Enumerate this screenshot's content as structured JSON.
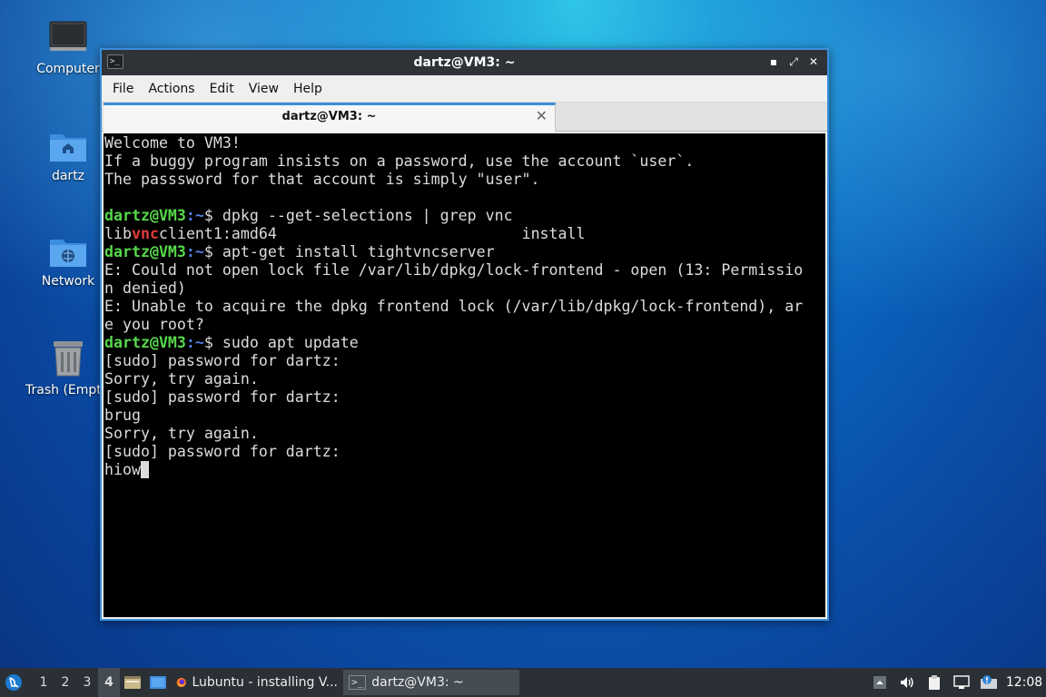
{
  "desktop": {
    "icons": [
      {
        "label": "Computer"
      },
      {
        "label": "dartz"
      },
      {
        "label": "Network"
      },
      {
        "label": "Trash (Empty)"
      }
    ]
  },
  "window": {
    "title": "dartz@VM3: ~",
    "menu": [
      "File",
      "Actions",
      "Edit",
      "View",
      "Help"
    ],
    "tab_label": "dartz@VM3: ~",
    "tab_close": "✕"
  },
  "terminal": {
    "lines": [
      {
        "text": "Welcome to VM3!"
      },
      {
        "text": "If a buggy program insists on a password, use the account `user`."
      },
      {
        "text": "The passsword for that account is simply \"user\"."
      },
      {
        "text": ""
      },
      {
        "prompt_user": "dartz@VM3",
        "prompt_path": ":~",
        "prompt_sym": "$ ",
        "cmd": "dpkg --get-selections | grep vnc"
      },
      {
        "pre": "lib",
        "hl": "vnc",
        "post": "client1:amd64                           install"
      },
      {
        "prompt_user": "dartz@VM3",
        "prompt_path": ":~",
        "prompt_sym": "$ ",
        "cmd": "apt-get install tightvncserver"
      },
      {
        "text": "E: Could not open lock file /var/lib/dpkg/lock-frontend - open (13: Permissio"
      },
      {
        "text": "n denied)"
      },
      {
        "text": "E: Unable to acquire the dpkg frontend lock (/var/lib/dpkg/lock-frontend), ar"
      },
      {
        "text": "e you root?"
      },
      {
        "prompt_user": "dartz@VM3",
        "prompt_path": ":~",
        "prompt_sym": "$ ",
        "cmd": "sudo apt update"
      },
      {
        "text": "[sudo] password for dartz:"
      },
      {
        "text": "Sorry, try again."
      },
      {
        "text": "[sudo] password for dartz:"
      },
      {
        "text": "brug"
      },
      {
        "text": "Sorry, try again."
      },
      {
        "text": "[sudo] password for dartz:"
      },
      {
        "text": "hiow",
        "cursor": true
      }
    ]
  },
  "taskbar": {
    "workspaces": [
      "1",
      "2",
      "3",
      "4"
    ],
    "active_workspace": "4",
    "tasks": [
      {
        "label": "Lubuntu - installing V...",
        "icon": "firefox-icon"
      },
      {
        "label": "dartz@VM3: ~",
        "icon": "terminal-icon"
      }
    ],
    "clock": "12:08"
  },
  "colors": {
    "prompt_user": "#56d84a",
    "prompt_path": "#4f7de6",
    "highlight": "#e23a3a",
    "window_border": "#3a8fd9"
  }
}
